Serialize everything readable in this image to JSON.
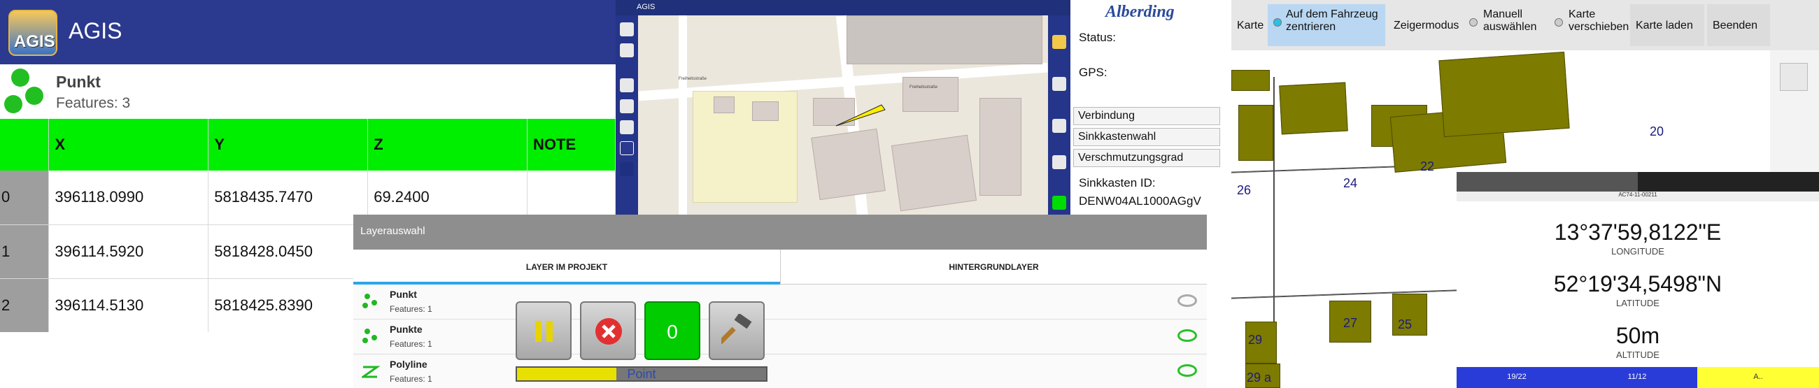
{
  "agis": {
    "app_title": "AGIS",
    "logo_text": "AGIS",
    "layer_name": "Punkt",
    "layer_features": "Features: 3",
    "columns": [
      "",
      "X",
      "Y",
      "Z",
      "NOTE"
    ],
    "rows": [
      [
        "0",
        "396118.0990",
        "5818435.7470",
        "69.2400",
        ""
      ],
      [
        "1",
        "396114.5920",
        "5818428.0450",
        "",
        ""
      ],
      [
        "2",
        "396114.5130",
        "5818425.8390",
        "",
        ""
      ]
    ]
  },
  "map": {
    "status_title": "AGIS",
    "streets": [
      "Freiheitsstraße",
      "Freiheitsstraße"
    ]
  },
  "alberding": {
    "logo": "Alberding",
    "status_label": "Status:",
    "gps_label": "GPS:",
    "buttons": [
      "Verbindung",
      "Sinkkastenwahl",
      "Verschmutzungsgrad"
    ],
    "sinkkasten_label": "Sinkkasten ID:",
    "sinkkasten_id": "DENW04AL1000AGgV"
  },
  "layer_dialog": {
    "title": "Layerauswahl",
    "tabs": [
      "LAYER IM PROJEKT",
      "HINTERGRUNDLAYER"
    ],
    "layers": [
      {
        "name": "Punkt",
        "sub": "Features: 1",
        "visible": false
      },
      {
        "name": "Punkte",
        "sub": "Features: 1",
        "visible": true
      },
      {
        "name": "Polyline",
        "sub": "Features: 1",
        "visible": true
      }
    ],
    "counter": "0",
    "progress_label": "Point",
    "progress_fraction": 0.4
  },
  "cadastre": {
    "toolbar": {
      "karte": "Karte",
      "center": "Auf dem Fahrzeug zentrieren",
      "mode": "Zeigermodus",
      "manual": "Manuell auswählen",
      "move": "Karte verschieben",
      "load": "Karte laden",
      "exit": "Beenden"
    },
    "house_numbers": [
      "20",
      "22",
      "24",
      "26",
      "27",
      "25",
      "29",
      "29 a"
    ],
    "gps": {
      "tabs": [
        "",
        ""
      ],
      "subtitle": "AC74-11-00211",
      "longitude": "13°37'59,8122\"E",
      "longitude_label": "LONGITUDE",
      "latitude": "52°19'34,5498\"N",
      "latitude_label": "LATITUDE",
      "altitude": "50m",
      "altitude_label": "ALTITUDE",
      "bars": [
        "19/22",
        "11/12",
        "A.."
      ]
    }
  },
  "colors": {
    "appbar": "#2b3a8f",
    "header_green": "#00ee00",
    "building_olive": "#7d7b00",
    "accent_blue": "#2aa6e8"
  }
}
